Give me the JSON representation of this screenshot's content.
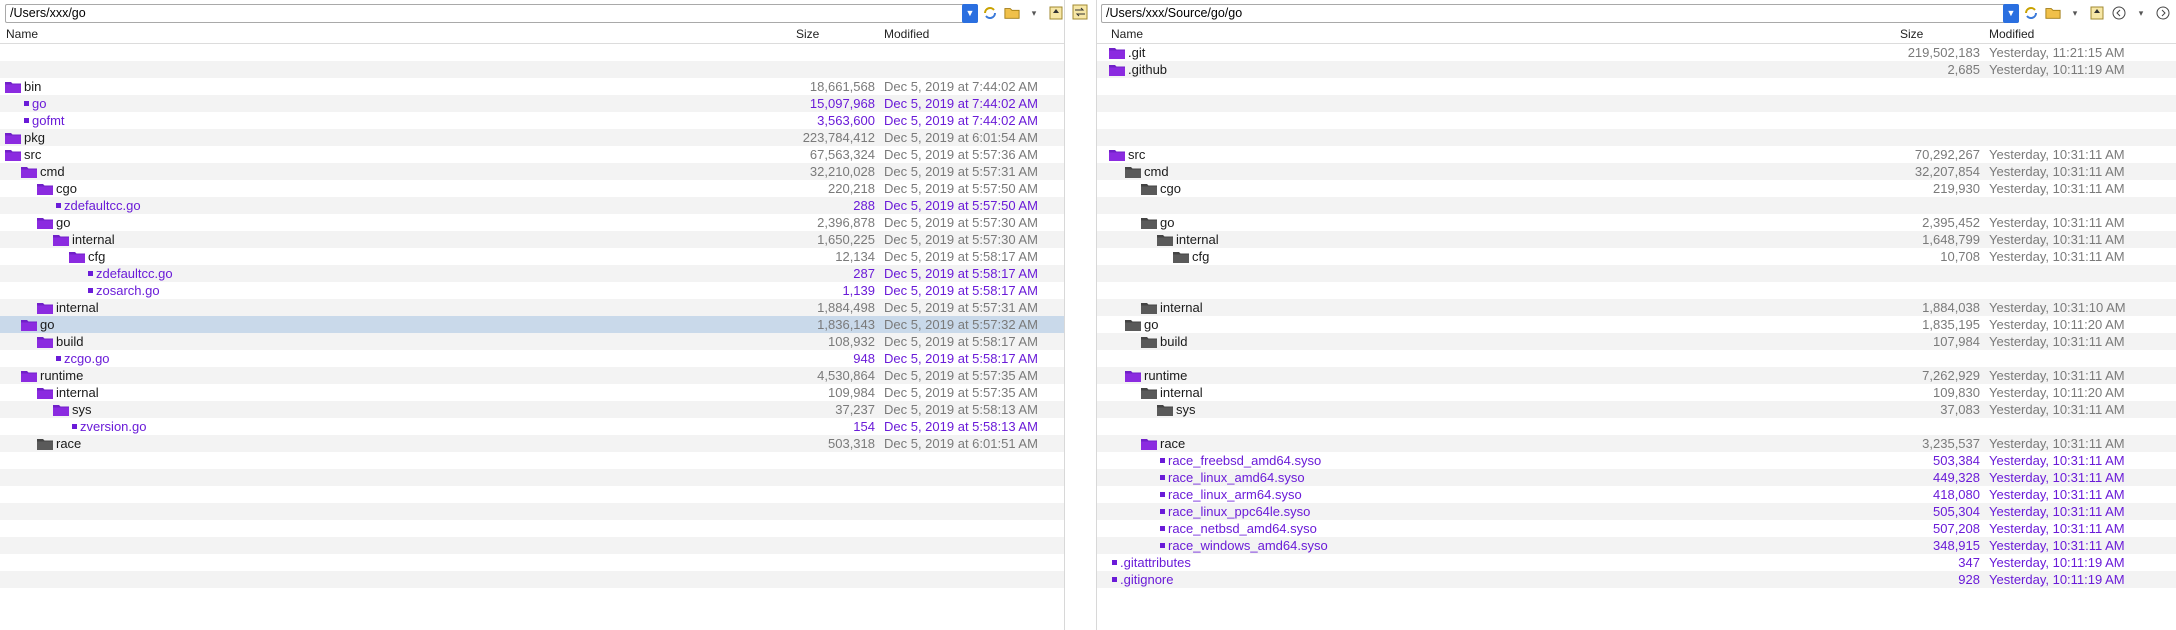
{
  "left": {
    "path": "/Users/xxx/go",
    "columns": {
      "name": "Name",
      "size": "Size",
      "modified": "Modified"
    },
    "rows": [
      {
        "type": "blank"
      },
      {
        "type": "blank"
      },
      {
        "type": "folder",
        "depth": 0,
        "name": "bin",
        "size": "18,661,568",
        "modified": "Dec 5, 2019 at 7:44:02 AM",
        "color": "gray",
        "icon": "purple"
      },
      {
        "type": "file",
        "depth": 1,
        "name": "go",
        "size": "15,097,968",
        "modified": "Dec 5, 2019 at 7:44:02 AM",
        "color": "purple"
      },
      {
        "type": "file",
        "depth": 1,
        "name": "gofmt",
        "size": "3,563,600",
        "modified": "Dec 5, 2019 at 7:44:02 AM",
        "color": "purple"
      },
      {
        "type": "folder",
        "depth": 0,
        "name": "pkg",
        "size": "223,784,412",
        "modified": "Dec 5, 2019 at 6:01:54 AM",
        "color": "gray",
        "icon": "purple"
      },
      {
        "type": "folder",
        "depth": 0,
        "name": "src",
        "size": "67,563,324",
        "modified": "Dec 5, 2019 at 5:57:36 AM",
        "color": "gray",
        "icon": "purple"
      },
      {
        "type": "folder",
        "depth": 1,
        "name": "cmd",
        "size": "32,210,028",
        "modified": "Dec 5, 2019 at 5:57:31 AM",
        "color": "gray",
        "icon": "purple"
      },
      {
        "type": "folder",
        "depth": 2,
        "name": "cgo",
        "size": "220,218",
        "modified": "Dec 5, 2019 at 5:57:50 AM",
        "color": "gray",
        "icon": "purple"
      },
      {
        "type": "file",
        "depth": 3,
        "name": "zdefaultcc.go",
        "size": "288",
        "modified": "Dec 5, 2019 at 5:57:50 AM",
        "color": "purple"
      },
      {
        "type": "folder",
        "depth": 2,
        "name": "go",
        "size": "2,396,878",
        "modified": "Dec 5, 2019 at 5:57:30 AM",
        "color": "gray",
        "icon": "purple"
      },
      {
        "type": "folder",
        "depth": 3,
        "name": "internal",
        "size": "1,650,225",
        "modified": "Dec 5, 2019 at 5:57:30 AM",
        "color": "gray",
        "icon": "purple"
      },
      {
        "type": "folder",
        "depth": 4,
        "name": "cfg",
        "size": "12,134",
        "modified": "Dec 5, 2019 at 5:58:17 AM",
        "color": "gray",
        "icon": "purple"
      },
      {
        "type": "file",
        "depth": 5,
        "name": "zdefaultcc.go",
        "size": "287",
        "modified": "Dec 5, 2019 at 5:58:17 AM",
        "color": "purple"
      },
      {
        "type": "file",
        "depth": 5,
        "name": "zosarch.go",
        "size": "1,139",
        "modified": "Dec 5, 2019 at 5:58:17 AM",
        "color": "purple"
      },
      {
        "type": "folder",
        "depth": 2,
        "name": "internal",
        "size": "1,884,498",
        "modified": "Dec 5, 2019 at 5:57:31 AM",
        "color": "gray",
        "icon": "purple"
      },
      {
        "type": "folder",
        "depth": 1,
        "name": "go",
        "size": "1,836,143",
        "modified": "Dec 5, 2019 at 5:57:32 AM",
        "color": "gray",
        "icon": "purple",
        "selected": true
      },
      {
        "type": "folder",
        "depth": 2,
        "name": "build",
        "size": "108,932",
        "modified": "Dec 5, 2019 at 5:58:17 AM",
        "color": "gray",
        "icon": "purple"
      },
      {
        "type": "file",
        "depth": 3,
        "name": "zcgo.go",
        "size": "948",
        "modified": "Dec 5, 2019 at 5:58:17 AM",
        "color": "purple"
      },
      {
        "type": "folder",
        "depth": 1,
        "name": "runtime",
        "size": "4,530,864",
        "modified": "Dec 5, 2019 at 5:57:35 AM",
        "color": "gray",
        "icon": "purple"
      },
      {
        "type": "folder",
        "depth": 2,
        "name": "internal",
        "size": "109,984",
        "modified": "Dec 5, 2019 at 5:57:35 AM",
        "color": "gray",
        "icon": "purple"
      },
      {
        "type": "folder",
        "depth": 3,
        "name": "sys",
        "size": "37,237",
        "modified": "Dec 5, 2019 at 5:58:13 AM",
        "color": "gray",
        "icon": "purple"
      },
      {
        "type": "file",
        "depth": 4,
        "name": "zversion.go",
        "size": "154",
        "modified": "Dec 5, 2019 at 5:58:13 AM",
        "color": "purple"
      },
      {
        "type": "folder",
        "depth": 2,
        "name": "race",
        "size": "503,318",
        "modified": "Dec 5, 2019 at 6:01:51 AM",
        "color": "gray",
        "icon": "gray"
      },
      {
        "type": "blank"
      },
      {
        "type": "blank"
      },
      {
        "type": "blank"
      },
      {
        "type": "blank"
      },
      {
        "type": "blank"
      },
      {
        "type": "blank"
      },
      {
        "type": "blank"
      },
      {
        "type": "blank"
      },
      {
        "type": "blank"
      }
    ]
  },
  "right": {
    "path": "/Users/xxx/Source/go/go",
    "columns": {
      "name": "Name",
      "size": "Size",
      "modified": "Modified"
    },
    "rows": [
      {
        "type": "folder",
        "depth": 0,
        "name": ".git",
        "size": "219,502,183",
        "modified": "Yesterday, 11:21:15 AM",
        "color": "gray",
        "icon": "purple"
      },
      {
        "type": "folder",
        "depth": 0,
        "name": ".github",
        "size": "2,685",
        "modified": "Yesterday, 10:11:19 AM",
        "color": "gray",
        "icon": "purple"
      },
      {
        "type": "blank"
      },
      {
        "type": "blank"
      },
      {
        "type": "blank"
      },
      {
        "type": "blank"
      },
      {
        "type": "folder",
        "depth": 0,
        "name": "src",
        "size": "70,292,267",
        "modified": "Yesterday, 10:31:11 AM",
        "color": "gray",
        "icon": "purple"
      },
      {
        "type": "folder",
        "depth": 1,
        "name": "cmd",
        "size": "32,207,854",
        "modified": "Yesterday, 10:31:11 AM",
        "color": "gray",
        "icon": "gray"
      },
      {
        "type": "folder",
        "depth": 2,
        "name": "cgo",
        "size": "219,930",
        "modified": "Yesterday, 10:31:11 AM",
        "color": "gray",
        "icon": "gray"
      },
      {
        "type": "blank"
      },
      {
        "type": "folder",
        "depth": 2,
        "name": "go",
        "size": "2,395,452",
        "modified": "Yesterday, 10:31:11 AM",
        "color": "gray",
        "icon": "gray"
      },
      {
        "type": "folder",
        "depth": 3,
        "name": "internal",
        "size": "1,648,799",
        "modified": "Yesterday, 10:31:11 AM",
        "color": "gray",
        "icon": "gray"
      },
      {
        "type": "folder",
        "depth": 4,
        "name": "cfg",
        "size": "10,708",
        "modified": "Yesterday, 10:31:11 AM",
        "color": "gray",
        "icon": "gray"
      },
      {
        "type": "blank"
      },
      {
        "type": "blank"
      },
      {
        "type": "folder",
        "depth": 2,
        "name": "internal",
        "size": "1,884,038",
        "modified": "Yesterday, 10:31:10 AM",
        "color": "gray",
        "icon": "gray"
      },
      {
        "type": "folder",
        "depth": 1,
        "name": "go",
        "size": "1,835,195",
        "modified": "Yesterday, 10:11:20 AM",
        "color": "gray",
        "icon": "gray"
      },
      {
        "type": "folder",
        "depth": 2,
        "name": "build",
        "size": "107,984",
        "modified": "Yesterday, 10:31:11 AM",
        "color": "gray",
        "icon": "gray"
      },
      {
        "type": "blank"
      },
      {
        "type": "folder",
        "depth": 1,
        "name": "runtime",
        "size": "7,262,929",
        "modified": "Yesterday, 10:31:11 AM",
        "color": "gray",
        "icon": "purple"
      },
      {
        "type": "folder",
        "depth": 2,
        "name": "internal",
        "size": "109,830",
        "modified": "Yesterday, 10:11:20 AM",
        "color": "gray",
        "icon": "gray"
      },
      {
        "type": "folder",
        "depth": 3,
        "name": "sys",
        "size": "37,083",
        "modified": "Yesterday, 10:31:11 AM",
        "color": "gray",
        "icon": "gray"
      },
      {
        "type": "blank"
      },
      {
        "type": "folder",
        "depth": 2,
        "name": "race",
        "size": "3,235,537",
        "modified": "Yesterday, 10:31:11 AM",
        "color": "gray",
        "icon": "purple"
      },
      {
        "type": "file",
        "depth": 3,
        "name": "race_freebsd_amd64.syso",
        "size": "503,384",
        "modified": "Yesterday, 10:31:11 AM",
        "color": "purple"
      },
      {
        "type": "file",
        "depth": 3,
        "name": "race_linux_amd64.syso",
        "size": "449,328",
        "modified": "Yesterday, 10:31:11 AM",
        "color": "purple"
      },
      {
        "type": "file",
        "depth": 3,
        "name": "race_linux_arm64.syso",
        "size": "418,080",
        "modified": "Yesterday, 10:31:11 AM",
        "color": "purple"
      },
      {
        "type": "file",
        "depth": 3,
        "name": "race_linux_ppc64le.syso",
        "size": "505,304",
        "modified": "Yesterday, 10:31:11 AM",
        "color": "purple"
      },
      {
        "type": "file",
        "depth": 3,
        "name": "race_netbsd_amd64.syso",
        "size": "507,208",
        "modified": "Yesterday, 10:31:11 AM",
        "color": "purple"
      },
      {
        "type": "file",
        "depth": 3,
        "name": "race_windows_amd64.syso",
        "size": "348,915",
        "modified": "Yesterday, 10:31:11 AM",
        "color": "purple"
      },
      {
        "type": "file",
        "depth": 0,
        "name": ".gitattributes",
        "size": "347",
        "modified": "Yesterday, 10:11:19 AM",
        "color": "purple"
      },
      {
        "type": "file",
        "depth": 0,
        "name": ".gitignore",
        "size": "928",
        "modified": "Yesterday, 10:11:19 AM",
        "color": "purple"
      },
      {
        "type": "blank"
      }
    ]
  },
  "icons": {
    "path_dropdown": "chevron-down-icon",
    "toolbar": [
      "sync-icon",
      "folder-open-icon",
      "dropdown-icon",
      "go-up-icon",
      "swap-panes-icon",
      "back-icon",
      "forward-icon"
    ]
  },
  "colors": {
    "purple": "#6a1bd8",
    "gray": "#7a7a7a",
    "selection": "#c9d9ea",
    "accent": "#2a6fe0"
  }
}
